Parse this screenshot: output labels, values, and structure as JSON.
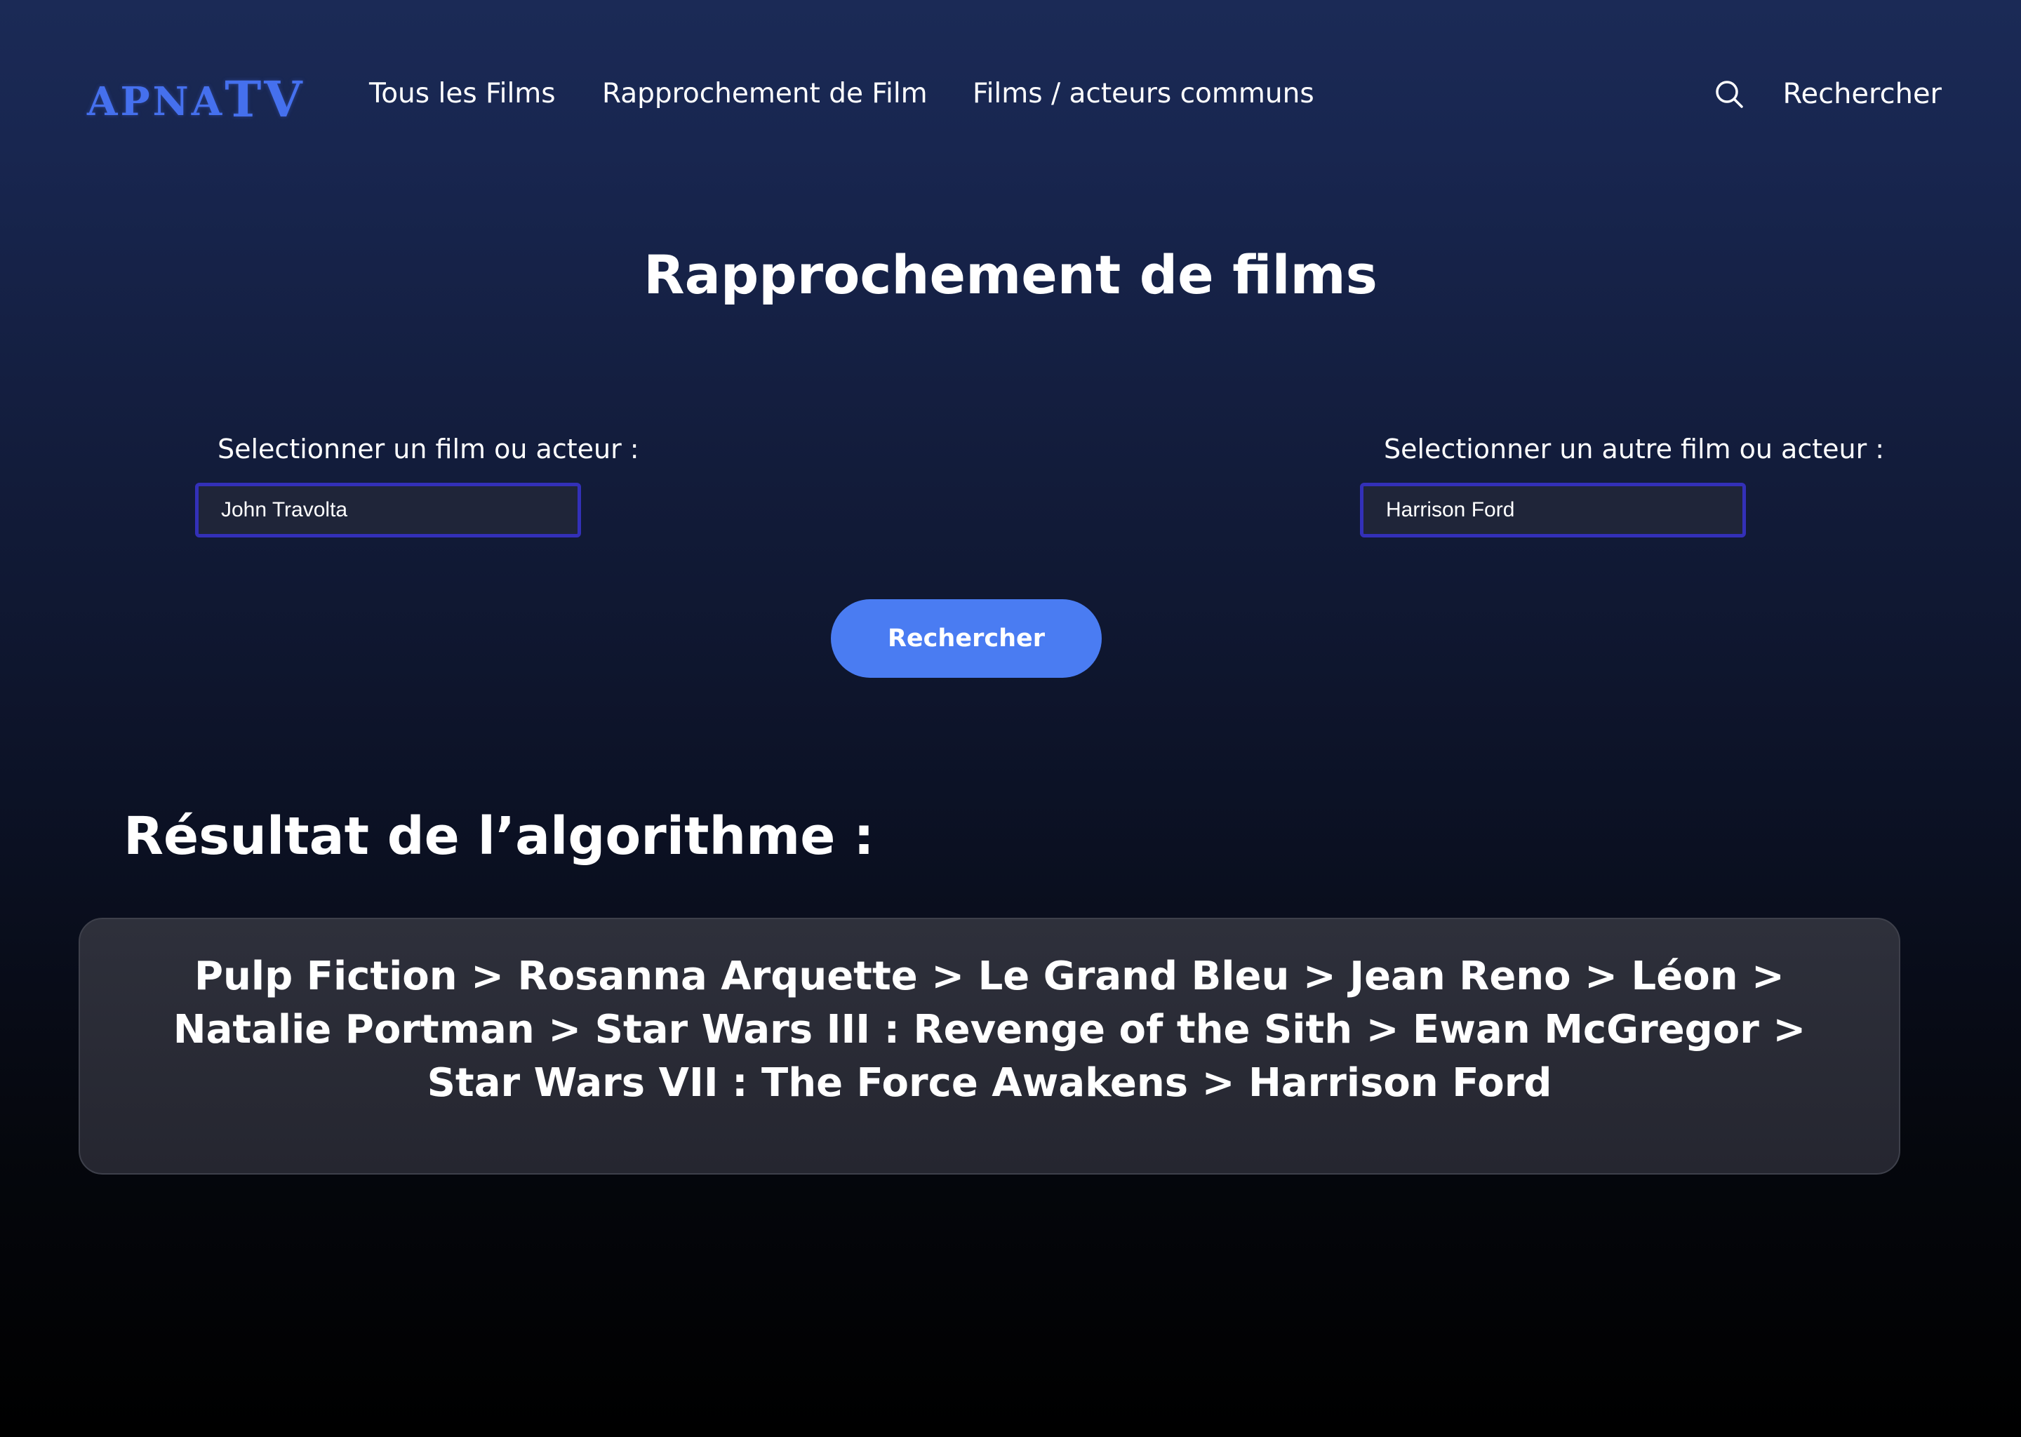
{
  "header": {
    "logo_small": "APNA",
    "logo_big": "TV",
    "nav": [
      {
        "label": "Tous les Films"
      },
      {
        "label": "Rapprochement de Film"
      },
      {
        "label": "Films / acteurs communs"
      }
    ],
    "search_icon": "search-icon",
    "search_label": "Rechercher"
  },
  "main": {
    "title": "Rapprochement de films",
    "left_field": {
      "label": "Selectionner un film ou acteur :",
      "value": "John Travolta"
    },
    "right_field": {
      "label": "Selectionner un autre film ou acteur :",
      "value": "Harrison Ford"
    },
    "search_button": "Rechercher"
  },
  "result": {
    "heading": "Résultat de l’algorithme :",
    "text": "Pulp Fiction > Rosanna Arquette > Le Grand Bleu > Jean Reno > Léon > Natalie Portman > Star Wars III : Revenge of the Sith > Ewan McGregor > Star Wars VII : The Force Awakens > Harrison Ford"
  },
  "colors": {
    "accent": "#4a7cf2",
    "logo": "#4570ee",
    "input_border": "#3330b8",
    "result_box": "#2a2c36"
  }
}
